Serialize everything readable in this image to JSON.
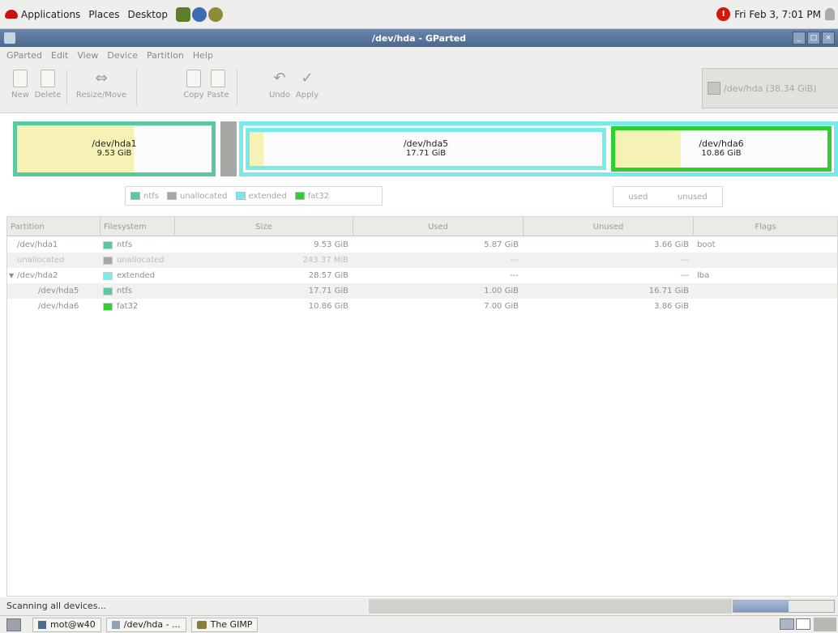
{
  "top_panel": {
    "menus": [
      "Applications",
      "Places",
      "Desktop"
    ],
    "clock": "Fri Feb  3,  7:01 PM"
  },
  "window": {
    "title": "/dev/hda - GParted"
  },
  "menubar": {
    "items": [
      "GParted",
      "Edit",
      "View",
      "Device",
      "Partition",
      "Help"
    ]
  },
  "toolbar": {
    "new_label": "New",
    "delete_label": "Delete",
    "resize_label": "Resize/Move",
    "copy_label": "Copy",
    "paste_label": "Paste",
    "undo_label": "Undo",
    "apply_label": "Apply",
    "device_label": "/dev/hda  (38.34 GiB)"
  },
  "disk_map": {
    "partitions": [
      {
        "label": "/dev/hda1",
        "size": "9.53 GiB",
        "used_fraction": 0.6,
        "color": "#5ac8a0"
      },
      {
        "label": "/dev/hda5",
        "size": "17.71 GiB",
        "used_fraction": 0.04,
        "color": "#77eaea"
      },
      {
        "label": "/dev/hda6",
        "size": "10.86 GiB",
        "used_fraction": 0.31,
        "color": "#32cd32"
      }
    ]
  },
  "legend": {
    "items": [
      {
        "label": "ntfs",
        "color": "#5ac8a0"
      },
      {
        "label": "unallocated",
        "color": "#a7a7a4"
      },
      {
        "label": "extended",
        "color": "#77eaea"
      },
      {
        "label": "fat32",
        "color": "#32cd32"
      }
    ],
    "used_label": "used",
    "unused_label": "unused"
  },
  "table": {
    "columns": [
      "Partition",
      "Filesystem",
      "Size",
      "Used",
      "Unused",
      "Flags"
    ],
    "rows": [
      {
        "partition": "/dev/hda1",
        "filesystem": "ntfs",
        "fs_color": "#5ac8a0",
        "size": "9.53 GiB",
        "used": "5.87 GiB",
        "unused": "3.66 GiB",
        "flags": "boot",
        "indent": 1,
        "dim": false
      },
      {
        "partition": "unallocated",
        "filesystem": "unallocated",
        "fs_color": "#a7a7a4",
        "size": "243.37 MiB",
        "used": "---",
        "unused": "---",
        "flags": "",
        "indent": 1,
        "dim": true
      },
      {
        "partition": "/dev/hda2",
        "filesystem": "extended",
        "fs_color": "#77eaea",
        "size": "28.57 GiB",
        "used": "---",
        "unused": "---",
        "flags": "lba",
        "indent": 0,
        "dim": false,
        "expander": "▼"
      },
      {
        "partition": "/dev/hda5",
        "filesystem": "ntfs",
        "fs_color": "#5ac8a0",
        "size": "17.71 GiB",
        "used": "1.00 GiB",
        "unused": "16.71 GiB",
        "flags": "",
        "indent": 2,
        "dim": false
      },
      {
        "partition": "/dev/hda6",
        "filesystem": "fat32",
        "fs_color": "#32cd32",
        "size": "10.86 GiB",
        "used": "7.00 GiB",
        "unused": "3.86 GiB",
        "flags": "",
        "indent": 2,
        "dim": false
      }
    ]
  },
  "status": {
    "text": "Scanning all devices...",
    "progress": 0.55
  },
  "taskbar": {
    "items": [
      "mot@w40",
      "/dev/hda - ...",
      "The GIMP"
    ]
  }
}
